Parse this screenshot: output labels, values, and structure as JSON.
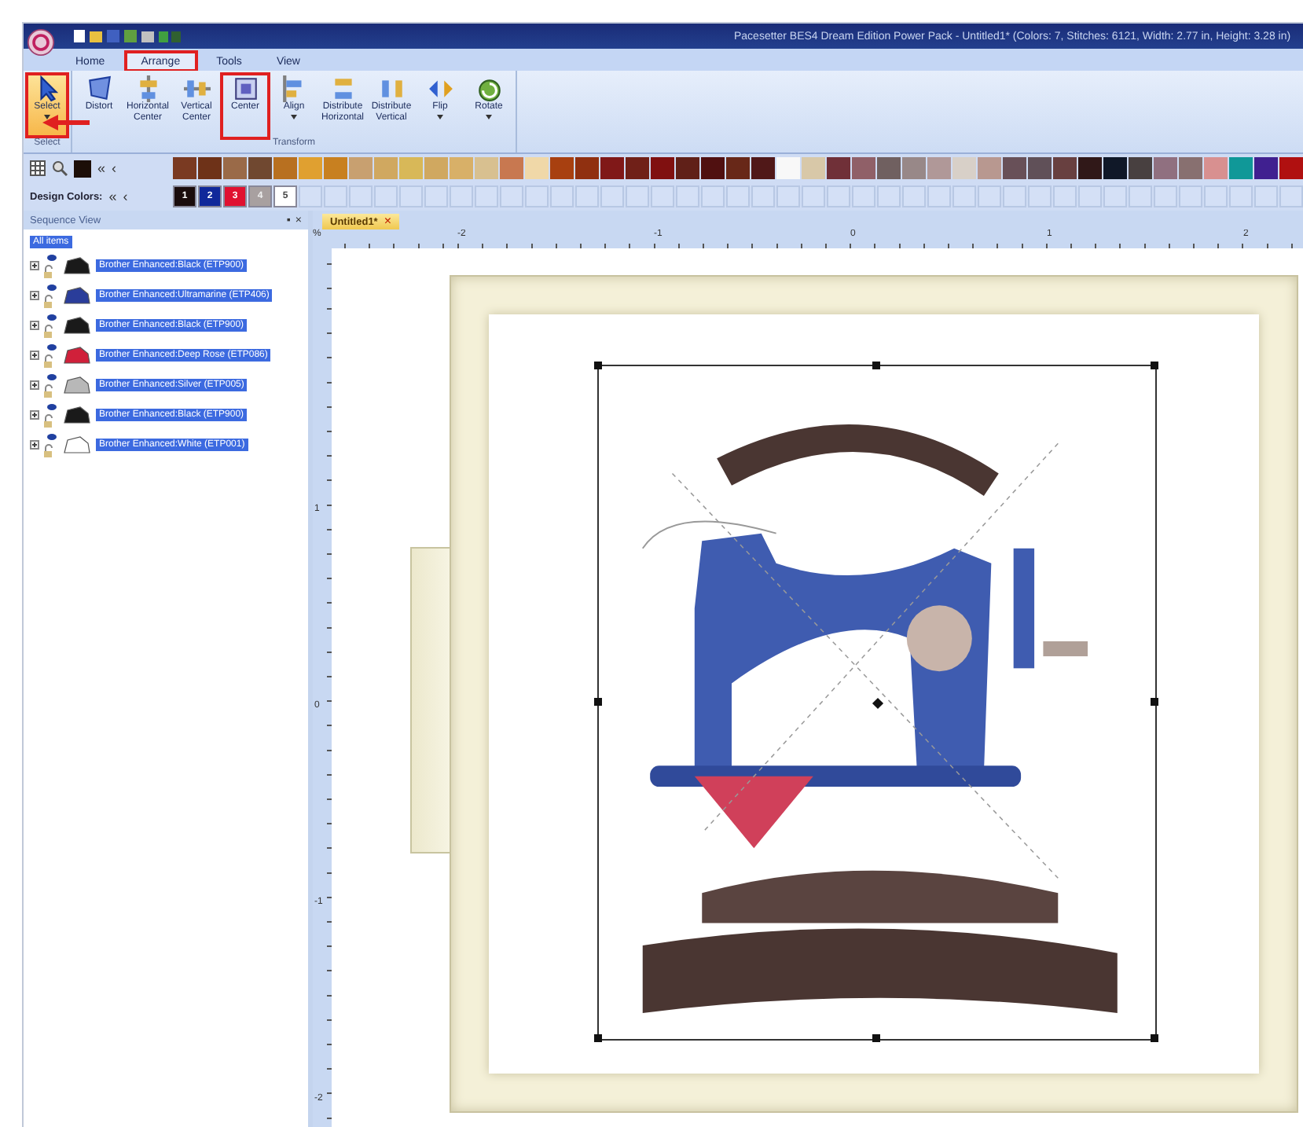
{
  "window": {
    "title": "Pacesetter BES4 Dream Edition Power Pack - Untitled1* (Colors: 7, Stitches: 6121, Width: 2.77 in, Height: 3.28 in)"
  },
  "tabs": [
    {
      "label": "Home",
      "selected": false,
      "callout": false
    },
    {
      "label": "Arrange",
      "selected": true,
      "callout": true
    },
    {
      "label": "Tools",
      "selected": false,
      "callout": false
    },
    {
      "label": "View",
      "selected": false,
      "callout": false
    }
  ],
  "ribbon": {
    "groups": [
      {
        "label": "Select",
        "buttons": [
          {
            "kind": "select",
            "label": "Select",
            "selected": true,
            "callout": true,
            "dropdown": true
          }
        ]
      },
      {
        "label": "Transform",
        "buttons": [
          {
            "kind": "distort",
            "label": "Distort",
            "selected": false,
            "callout": false,
            "dropdown": false
          },
          {
            "kind": "hcenter",
            "label": "Horizontal Center",
            "selected": false,
            "callout": false,
            "dropdown": false
          },
          {
            "kind": "vcenter",
            "label": "Vertical Center",
            "selected": false,
            "callout": false,
            "dropdown": false
          },
          {
            "kind": "center",
            "label": "Center",
            "selected": false,
            "callout": true,
            "dropdown": false
          },
          {
            "kind": "align",
            "label": "Align",
            "selected": false,
            "callout": false,
            "dropdown": true
          },
          {
            "kind": "dhoriz",
            "label": "Distribute Horizontal",
            "selected": false,
            "callout": false,
            "dropdown": false
          },
          {
            "kind": "dvert",
            "label": "Distribute Vertical",
            "selected": false,
            "callout": false,
            "dropdown": false
          },
          {
            "kind": "flip",
            "label": "Flip",
            "selected": false,
            "callout": false,
            "dropdown": true
          },
          {
            "kind": "rotate",
            "label": "Rotate",
            "selected": false,
            "callout": false,
            "dropdown": true
          }
        ]
      }
    ]
  },
  "palette": {
    "first": "«",
    "prev": "‹",
    "current_swatch": {
      "color": "#1c0e08"
    },
    "colors": [
      {
        "color": "#7a3a22"
      },
      {
        "color": "#6e3218"
      },
      {
        "color": "#9a6a48"
      },
      {
        "color": "#704830"
      },
      {
        "color": "#b87020"
      },
      {
        "color": "#e0a030"
      },
      {
        "color": "#c88020"
      },
      {
        "color": "#c8a070"
      },
      {
        "color": "#d0a860"
      },
      {
        "color": "#d8b858"
      },
      {
        "color": "#d0a860"
      },
      {
        "color": "#d8b068"
      },
      {
        "color": "#d8c090"
      },
      {
        "color": "#c87850"
      },
      {
        "color": "#f0d8a8"
      },
      {
        "color": "#a84010"
      },
      {
        "color": "#903010"
      },
      {
        "color": "#801818"
      },
      {
        "color": "#702018"
      },
      {
        "color": "#801010"
      },
      {
        "color": "#602018"
      },
      {
        "color": "#501010"
      },
      {
        "color": "#682818"
      },
      {
        "color": "#501818"
      },
      {
        "color": "#f8f8f8"
      },
      {
        "color": "#d8c8a8"
      },
      {
        "color": "#703038"
      },
      {
        "color": "#906068"
      },
      {
        "color": "#706060"
      },
      {
        "color": "#988888"
      },
      {
        "color": "#b09898"
      },
      {
        "color": "#d8d0c8"
      },
      {
        "color": "#b89890"
      },
      {
        "color": "#685058"
      },
      {
        "color": "#605058"
      },
      {
        "color": "#684040"
      },
      {
        "color": "#301818"
      },
      {
        "color": "#101828"
      },
      {
        "color": "#484040"
      },
      {
        "color": "#907080"
      },
      {
        "color": "#887070"
      },
      {
        "color": "#d89090"
      },
      {
        "color": "#109898"
      },
      {
        "color": "#402090"
      },
      {
        "color": "#b01010"
      }
    ]
  },
  "design_colors": {
    "label": "Design Colors:",
    "first": "«",
    "prev": "‹",
    "colors": [
      {
        "number": "1",
        "color": "#1a0c0c"
      },
      {
        "number": "2",
        "color": "#10289a"
      },
      {
        "number": "3",
        "color": "#e01030"
      },
      {
        "number": "4",
        "color": "#a8a0a0"
      },
      {
        "number": "5",
        "color": "#ffffff"
      }
    ]
  },
  "sequence_view": {
    "title": "Sequence View",
    "pin": "▪",
    "close": "×",
    "all_items": {
      "label": "All items",
      "selected": true
    },
    "items": [
      {
        "label": "Brother Enhanced:Black (ETP900)",
        "color": "#1a1a1a",
        "selected": true
      },
      {
        "label": "Brother Enhanced:Ultramarine (ETP406)",
        "color": "#2a3d9a",
        "selected": true
      },
      {
        "label": "Brother Enhanced:Black (ETP900)",
        "color": "#1a1a1a",
        "selected": true
      },
      {
        "label": "Brother Enhanced:Deep Rose (ETP086)",
        "color": "#d0203a",
        "selected": true
      },
      {
        "label": "Brother Enhanced:Silver (ETP005)",
        "color": "#b8b8b8",
        "selected": true
      },
      {
        "label": "Brother Enhanced:Black (ETP900)",
        "color": "#1a1a1a",
        "selected": true
      },
      {
        "label": "Brother Enhanced:White (ETP001)",
        "color": "#ffffff",
        "selected": true
      }
    ]
  },
  "document_tab": {
    "label": "Untitled1*",
    "close": "×"
  },
  "rulers": {
    "unit": "%",
    "horizontal": [
      "-2",
      "-1",
      "0",
      "1",
      "2"
    ],
    "vertical": [
      "1",
      "0",
      "-1",
      "-2"
    ]
  }
}
